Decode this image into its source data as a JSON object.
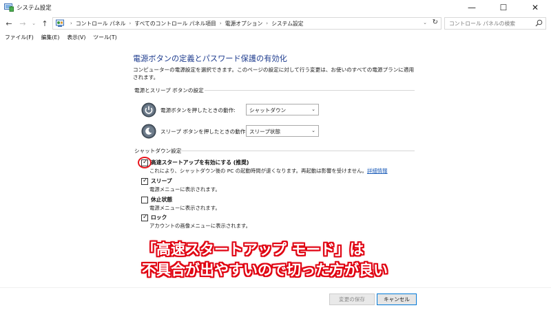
{
  "window": {
    "title": "システム設定",
    "controls": {
      "minimize": "—",
      "maximize": "☐",
      "close": "✕"
    }
  },
  "nav": {
    "back": "←",
    "forward": "→",
    "history": "⌄",
    "up": "↑",
    "breadcrumb_arrow": "›",
    "breadcrumbs": [
      "コントロール パネル",
      "すべてのコントロール パネル項目",
      "電源オプション",
      "システム設定"
    ],
    "dropdown": "⌄",
    "refresh": "↻",
    "search_placeholder": "コントロール パネルの検索"
  },
  "menu": [
    "ファイル(F)",
    "編集(E)",
    "表示(V)",
    "ツール(T)"
  ],
  "main": {
    "heading": "電源ボタンの定義とパスワード保護の有効化",
    "description": "コンピューターの電源設定を選択できます。このページの設定に対して行う変更は、お使いのすべての電源プランに適用されます。",
    "power_section": {
      "title": "電源とスリープ ボタンの設定",
      "rows": [
        {
          "label": "電源ボタンを押したときの動作:",
          "value": "シャットダウン",
          "icon": "power-icon"
        },
        {
          "label": "スリープ ボタンを押したときの動作:",
          "value": "スリープ状態",
          "icon": "sleep-icon"
        }
      ]
    },
    "shutdown_section": {
      "title": "シャットダウン設定",
      "items": [
        {
          "label": "高速スタートアップを有効にする (推奨)",
          "desc": "これにより、シャットダウン後の PC の起動時間が速くなります。再起動は影響を受けません。",
          "link": "詳細情報",
          "checked": true
        },
        {
          "label": "スリープ",
          "desc": "電源メニューに表示されます。",
          "checked": true
        },
        {
          "label": "休止状態",
          "desc": "電源メニューに表示されます。",
          "checked": false
        },
        {
          "label": "ロック",
          "desc": "アカウントの画像メニューに表示されます。",
          "checked": true
        }
      ]
    }
  },
  "annotation": {
    "line1": "「高速スタートアップ モード」は",
    "line2": "不具合が出やすいので切った方が良い",
    "color": "#e00010"
  },
  "buttons": {
    "save": "変更の保存",
    "cancel": "キャンセル"
  },
  "colors": {
    "heading": "#1f3d8f",
    "link": "#1a5bb8",
    "accent": "#0078d7"
  }
}
